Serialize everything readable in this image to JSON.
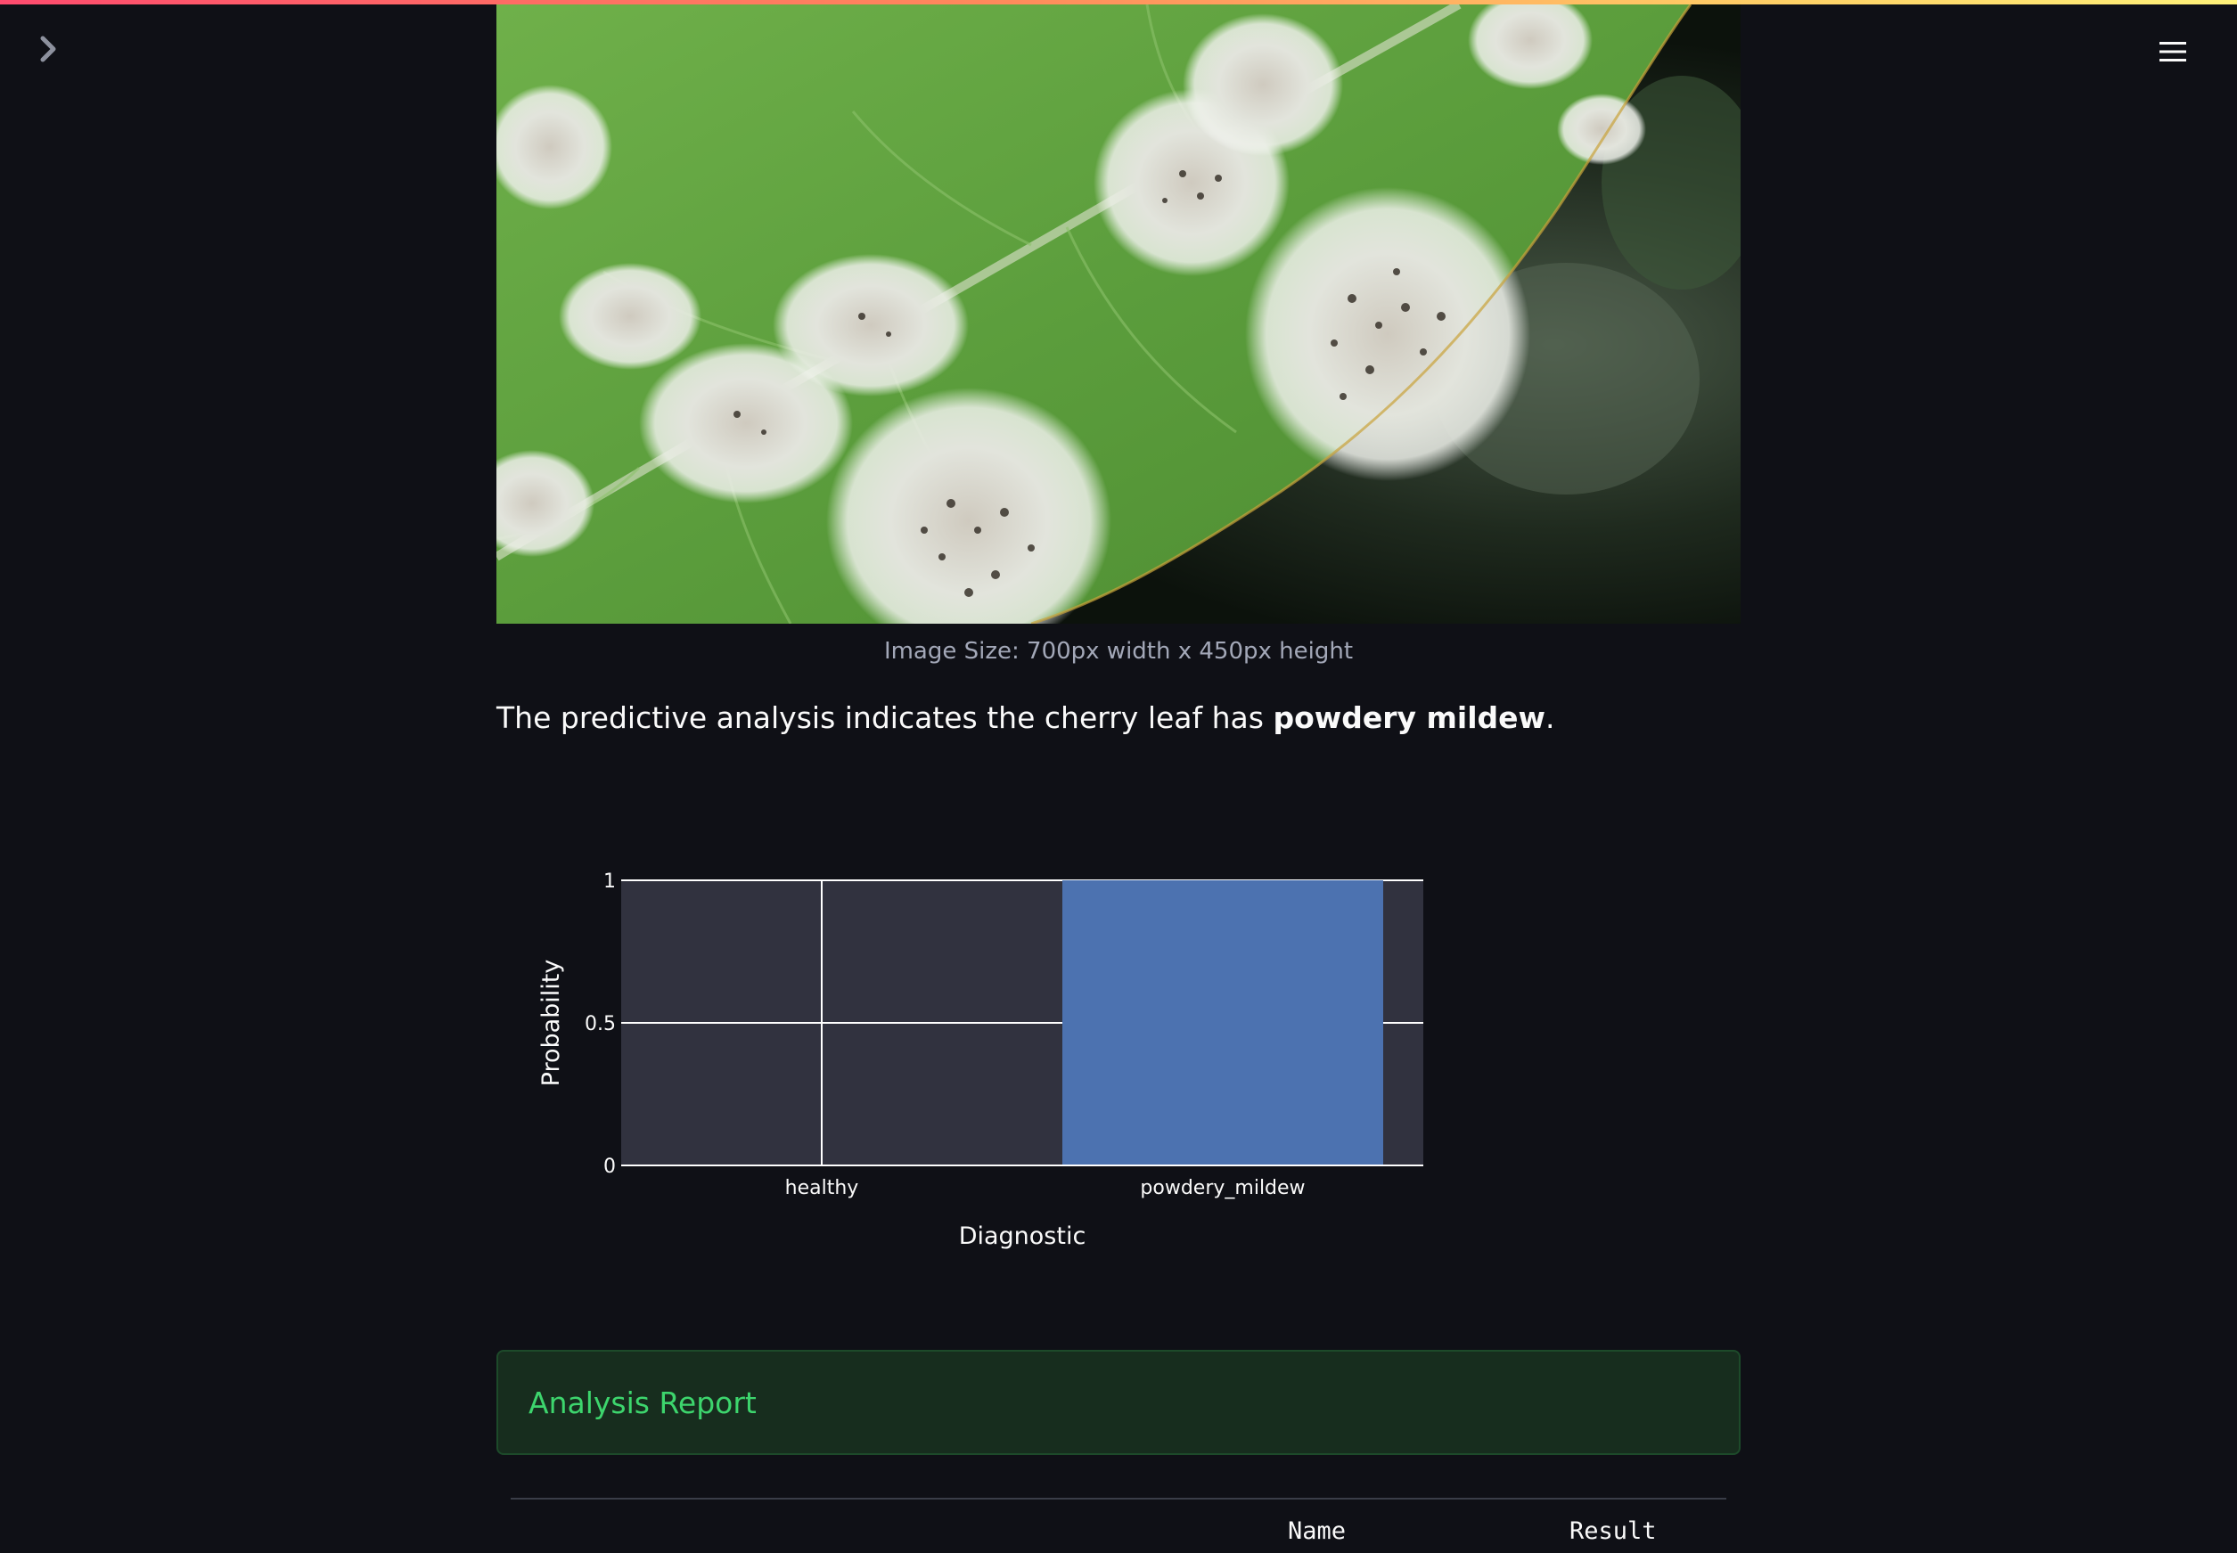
{
  "app": {
    "accent_gradient": [
      "#ff4b6e",
      "#ffd166"
    ],
    "sidebar_toggle_icon": "chevron-right-icon",
    "menu_icon": "hamburger-menu-icon"
  },
  "image": {
    "caption": "Image Size: 700px width x 450px height"
  },
  "prediction": {
    "prefix": "The predictive analysis indicates the cherry leaf has ",
    "diagnosis": "powdery mildew",
    "suffix": "."
  },
  "chart_data": {
    "type": "bar",
    "categories": [
      "healthy",
      "powdery_mildew"
    ],
    "values": [
      0,
      1
    ],
    "xlabel": "Diagnostic",
    "ylabel": "Probability",
    "ylim": [
      0,
      1
    ],
    "yticks": [
      "0",
      "0.5",
      "1"
    ],
    "bar_color": "#4c72b0",
    "background_color": "#31323f",
    "grid": true
  },
  "report": {
    "title": "Analysis Report",
    "columns": [
      "Name",
      "Result"
    ]
  }
}
